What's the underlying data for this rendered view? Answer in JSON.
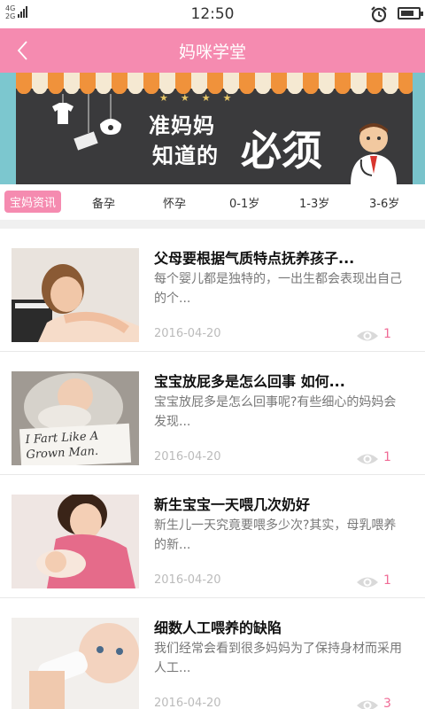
{
  "status_bar": {
    "network_top": "4G",
    "network_bottom": "2G",
    "time": "12:50"
  },
  "nav": {
    "title": "妈咪学堂",
    "back_icon": "chevron-left-icon"
  },
  "banner": {
    "line1": "准妈妈",
    "line2": "知道的",
    "big_text": "必须",
    "colors": {
      "awning_orange": "#f0923b",
      "board": "#3a3a3c"
    }
  },
  "tabs": [
    {
      "label": "宝妈资讯",
      "active": true
    },
    {
      "label": "备孕",
      "active": false
    },
    {
      "label": "怀孕",
      "active": false
    },
    {
      "label": "0-1岁",
      "active": false
    },
    {
      "label": "1-3岁",
      "active": false
    },
    {
      "label": "3-6岁",
      "active": false
    }
  ],
  "articles": [
    {
      "title": "父母要根据气质特点抚养孩子...",
      "desc": "每个婴儿都是独特的，一出生都会表现出自己的个...",
      "date": "2016-04-20",
      "views": "1",
      "thumb_sign": ""
    },
    {
      "title": "宝宝放屁多是怎么回事 如何...",
      "desc": "宝宝放屁多是怎么回事呢?有些细心的妈妈会发现...",
      "date": "2016-04-20",
      "views": "1",
      "thumb_sign": "I Fart Like A Grown Man."
    },
    {
      "title": "新生宝宝一天喂几次奶好",
      "desc": "新生儿一天究竟要喂多少次?其实，母乳喂养的新...",
      "date": "2016-04-20",
      "views": "1",
      "thumb_sign": ""
    },
    {
      "title": "细数人工喂养的缺陷",
      "desc": "我们经常会看到很多妈妈为了保持身材而采用人工...",
      "date": "2016-04-20",
      "views": "3",
      "thumb_sign": ""
    }
  ],
  "colors": {
    "accent": "#f58bb0",
    "count": "#f06b96"
  }
}
